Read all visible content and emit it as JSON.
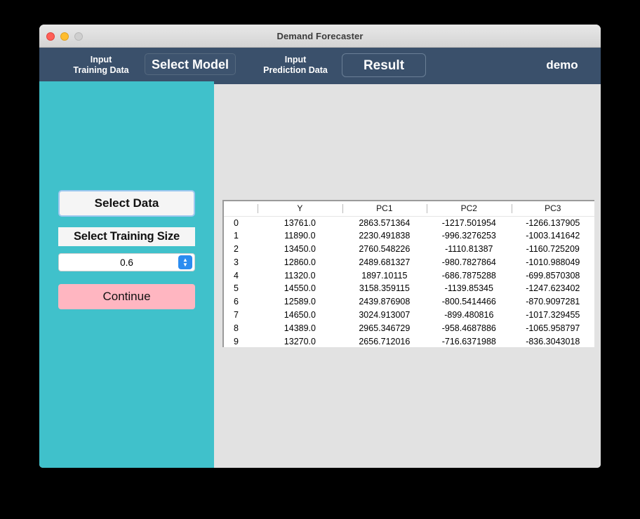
{
  "window": {
    "title": "Demand Forecaster",
    "traffic_lights": [
      "close",
      "minimize",
      "maximize"
    ]
  },
  "navbar": {
    "items": [
      {
        "label": "Input\nTraining Data",
        "name": "input-training-data"
      },
      {
        "label": "Select Model",
        "name": "select-model"
      },
      {
        "label": "Input\nPrediction Data",
        "name": "input-prediction-data"
      },
      {
        "label": "Result",
        "name": "result"
      }
    ],
    "user_label": "demo",
    "bg_color": "#3A506B",
    "accent_color": "#40C1CB"
  },
  "sidebar": {
    "bg_color": "#40C1CB",
    "select_data_button": "Select Data",
    "training_size_label": "Select Training Size",
    "training_size_value": "0.6",
    "continue_button": "Continue",
    "continue_color": "#FFB6C1"
  },
  "table": {
    "columns": [
      "",
      "Y",
      "PC1",
      "PC2",
      "PC3"
    ],
    "rows": [
      [
        "0",
        "13761.0",
        "2863.571364",
        "-1217.501954",
        "-1266.137905"
      ],
      [
        "1",
        "11890.0",
        "2230.491838",
        "-996.3276253",
        "-1003.141642"
      ],
      [
        "2",
        "13450.0",
        "2760.548226",
        "-1110.81387",
        "-1160.725209"
      ],
      [
        "3",
        "12860.0",
        "2489.681327",
        "-980.7827864",
        "-1010.988049"
      ],
      [
        "4",
        "11320.0",
        "1897.10115",
        "-686.7875288",
        "-699.8570308"
      ],
      [
        "5",
        "14550.0",
        "3158.359115",
        "-1139.85345",
        "-1247.623402"
      ],
      [
        "6",
        "12589.0",
        "2439.876908",
        "-800.5414466",
        "-870.9097281"
      ],
      [
        "7",
        "14650.0",
        "3024.913007",
        "-899.480816",
        "-1017.329455"
      ],
      [
        "8",
        "14389.0",
        "2965.346729",
        "-958.4687886",
        "-1065.958797"
      ],
      [
        "9",
        "13270.0",
        "2656.712016",
        "-716.6371988",
        "-836.3043018"
      ]
    ]
  }
}
